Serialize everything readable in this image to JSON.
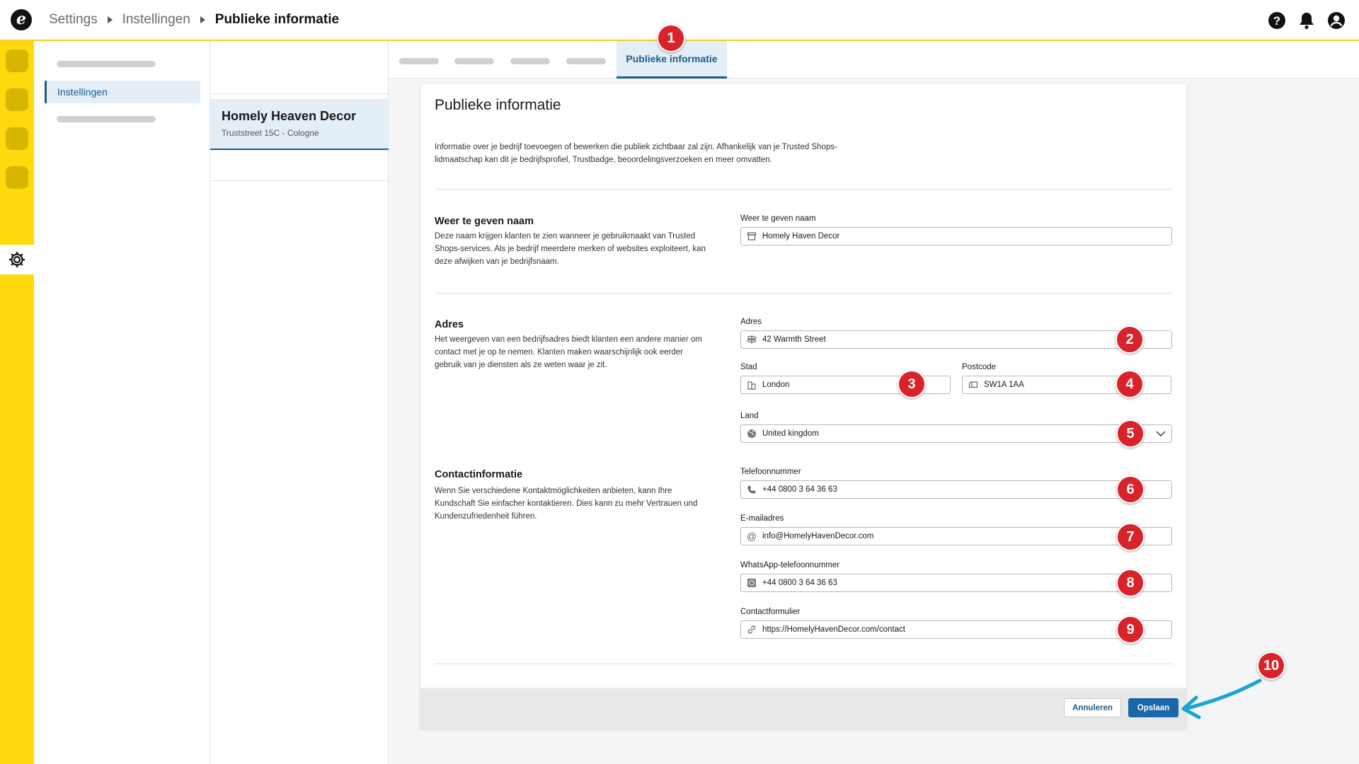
{
  "topbar": {
    "logo_letter": "e",
    "breadcrumb": [
      "Settings",
      "Instellingen",
      "Publieke informatie"
    ]
  },
  "nav": {
    "active_label": "Instellingen"
  },
  "shop": {
    "name": "Homely Heaven Decor",
    "address": "Truststreet 15C - Cologne"
  },
  "tabs": {
    "active_label": "Publieke informatie"
  },
  "page": {
    "title": "Publieke informatie",
    "intro": "Informatie over je bedrijf toevoegen of bewerken die publiek zichtbaar zal zijn. Afhankelijk van je Trusted Shops-lidmaatschap kan dit je bedrijfsprofiel, Trustbadge, beoordelingsverzoeken en meer omvatten."
  },
  "sections": {
    "name": {
      "title": "Weer te geven naam",
      "desc": "Deze naam krijgen klanten te zien wanneer je gebruikmaakt van Trusted Shops-services. Als je bedrijf meerdere merken of websites exploiteert, kan deze afwijken van je bedrijfsnaam.",
      "label": "Weer te geven naam",
      "value": "Homely Haven Decor"
    },
    "address": {
      "title": "Adres",
      "desc": "Het weergeven van een bedrijfsadres biedt klanten een andere manier om contact met je op te nemen. Klanten maken waarschijnlijk ook eerder gebruik van je diensten als ze weten waar je zit.",
      "street_label": "Adres",
      "street_value": "42 Warmth Street",
      "city_label": "Stad",
      "city_value": "London",
      "zip_label": "Postcode",
      "zip_value": "SW1A 1AA",
      "country_label": "Land",
      "country_value": "United kingdom"
    },
    "contact": {
      "title": "Contactinformatie",
      "desc": " Wenn Sie verschiedene Kontaktmöglichkeiten anbieten, kann Ihre Kundschaft Sie einfacher kontaktieren. Dies kann zu mehr Vertrauen und Kundenzufriedenheit führen.",
      "phone_label": "Telefoonnummer",
      "phone_value": "+44 0800 3 64 36 63",
      "email_label": "E-mailadres",
      "email_value": "info@HomelyHavenDecor.com",
      "whatsapp_label": "WhatsApp-telefoonnummer",
      "whatsapp_value": "+44 0800 3 64 36 63",
      "form_label": "Contactformulier",
      "form_value": "https://HomelyHavenDecor.com/contact"
    }
  },
  "footer": {
    "cancel_label": "Annuleren",
    "save_label": "Opslaan"
  },
  "badges": [
    "1",
    "2",
    "3",
    "4",
    "5",
    "6",
    "7",
    "8",
    "9",
    "10"
  ],
  "colors": {
    "brand_yellow": "#fdd90d",
    "accent_blue": "#1b5c91",
    "primary_button": "#1966a8",
    "badge_red": "#d8232a",
    "arrow_cyan": "#1aa3d6"
  }
}
